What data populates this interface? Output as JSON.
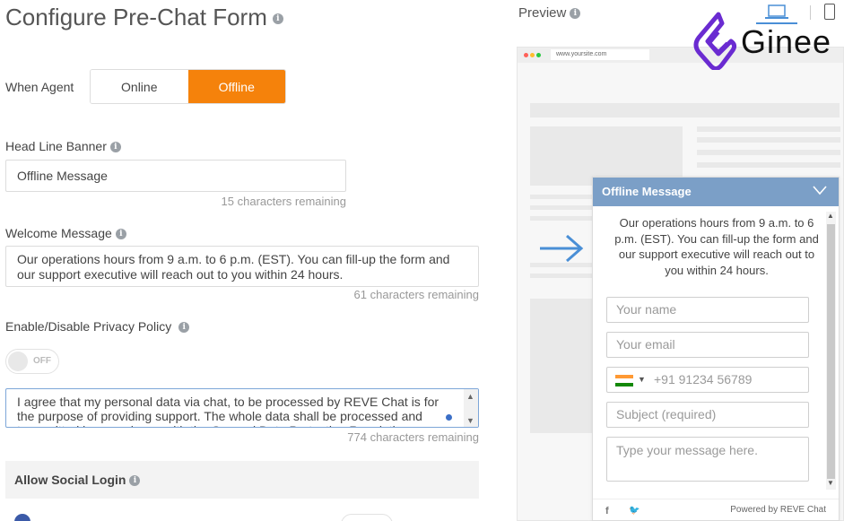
{
  "page": {
    "title": "Configure Pre-Chat Form"
  },
  "when_agent": {
    "label": "When Agent",
    "options": [
      "Online",
      "Offline"
    ],
    "selected": "Offline"
  },
  "headline": {
    "label": "Head Line Banner",
    "value": "Offline Message",
    "remaining": "15 characters remaining"
  },
  "welcome": {
    "label": "Welcome Message",
    "value": "Our operations hours from 9 a.m. to 6 p.m. (EST). You can fill-up the form and our support executive will reach out to you within 24 hours.",
    "remaining": "61 characters remaining"
  },
  "privacy": {
    "label": "Enable/Disable Privacy Policy",
    "switch_text": "OFF",
    "value": "I agree that my personal data via chat, to be processed by REVE Chat is for the purpose of providing support. The whole data shall be processed and transmitted in accordance with the General Data Protection Regulation",
    "remaining": "774 characters remaining"
  },
  "social": {
    "label": "Allow Social Login"
  },
  "preview": {
    "label": "Preview",
    "url": "www.yoursite.com"
  },
  "chat_widget": {
    "title": "Offline Message",
    "message": "Our operations hours from 9 a.m. to 6 p.m. (EST). You can fill-up the form and our support executive will reach out to you within 24 hours.",
    "name_placeholder": "Your name",
    "email_placeholder": "Your email",
    "phone_placeholder": "+91 91234 56789",
    "subject_placeholder": "Subject (required)",
    "message_placeholder": "Type your message here.",
    "powered_by": "Powered by",
    "brand": "REVE Chat",
    "facebook_glyph": "f",
    "twitter_glyph": "🐦"
  },
  "logo": {
    "text": "Ginee"
  },
  "colors": {
    "accent": "#f5820b",
    "chat_header": "#7b9fc7",
    "arrow": "#4a8fd6",
    "logo": "#6a2bd1"
  },
  "icons": [
    "info-icon",
    "desktop-icon",
    "mobile-icon",
    "chevron-down-icon",
    "arrow-right-icon",
    "facebook-icon",
    "twitter-icon"
  ]
}
